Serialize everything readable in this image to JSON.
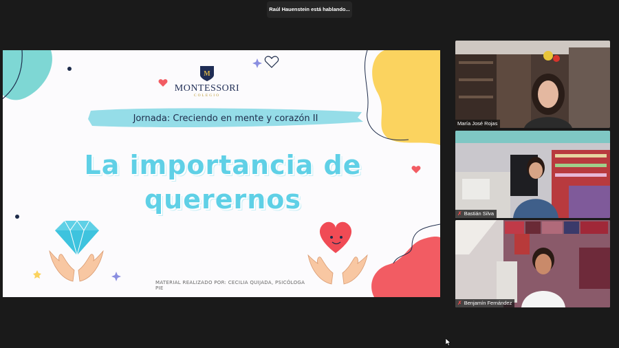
{
  "meeting": {
    "speaking_notice": "Raúl Hauenstein está hablando..."
  },
  "slide": {
    "logo_text": "MONTESSORI",
    "logo_sub": "COLEGIO",
    "banner": "Jornada: Creciendo en mente y corazón II",
    "title_line1": "La importancia de",
    "title_line2": "querernos",
    "credit": "MATERIAL REALIZADO POR: CECILIA QUIJADA, PSICÓLOGA PIE",
    "colors": {
      "teal": "#7ed7d4",
      "yellow": "#fbd35f",
      "coral": "#f25c63",
      "title_cyan": "#5fd0e6"
    }
  },
  "participants": [
    {
      "name": "María José Rojas",
      "muted": false
    },
    {
      "name": "Bastián Silva",
      "muted": true
    },
    {
      "name": "Benjamín Fernández",
      "muted": true
    }
  ],
  "icons": {
    "mic_off": "microphone-off-icon",
    "cursor": "mouse-pointer-icon"
  }
}
